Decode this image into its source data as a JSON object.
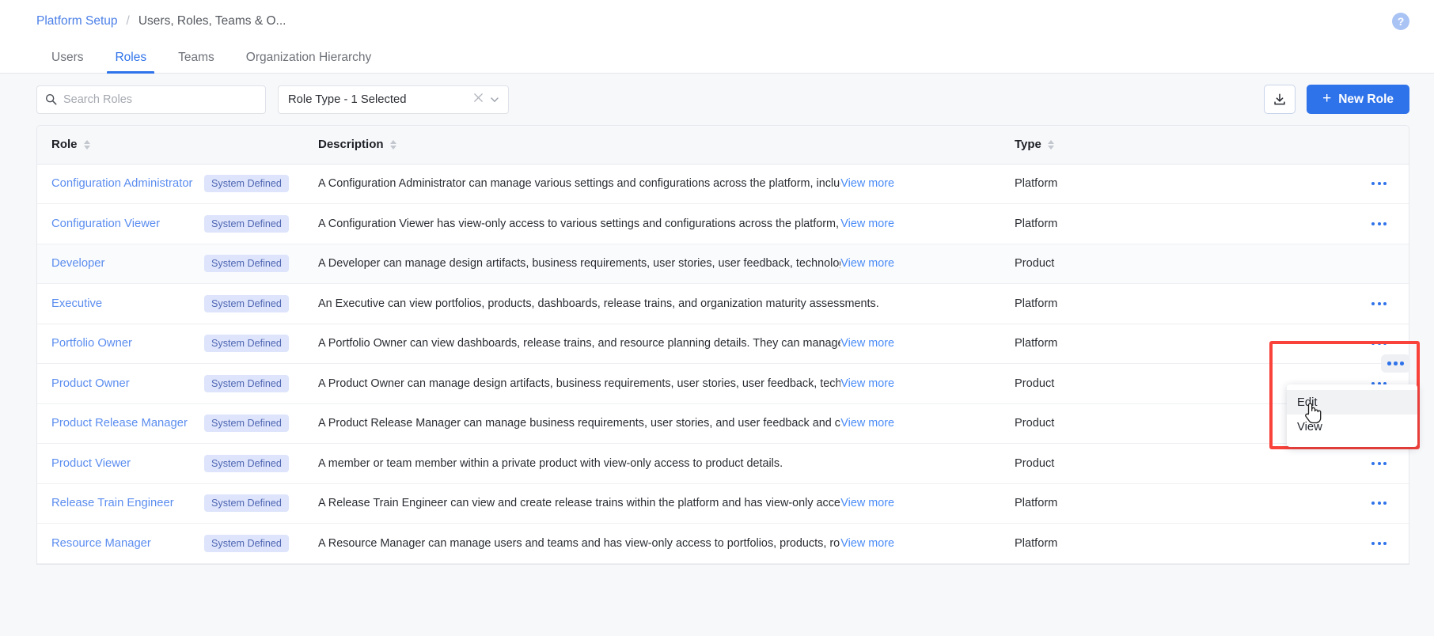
{
  "breadcrumb": {
    "root": "Platform Setup",
    "separator": "/",
    "current": "Users, Roles, Teams & O..."
  },
  "help": {
    "glyph": "?"
  },
  "tabs": [
    {
      "label": "Users",
      "active": false
    },
    {
      "label": "Roles",
      "active": true
    },
    {
      "label": "Teams",
      "active": false
    },
    {
      "label": "Organization Hierarchy",
      "active": false
    }
  ],
  "toolbar": {
    "search": {
      "placeholder": "Search Roles",
      "value": ""
    },
    "filter": {
      "label": "Role Type - 1 Selected"
    },
    "download_label": "Download",
    "new_role_label": "New Role",
    "new_role_plus": "+"
  },
  "colors": {
    "accent": "#2f73ea",
    "link": "#5b8def",
    "badge_bg": "#dde4fb",
    "badge_text": "#4f66b3",
    "highlight": "#f9423a"
  },
  "table": {
    "columns": [
      {
        "label": "Role",
        "sortable": true
      },
      {
        "label": "Description",
        "sortable": true
      },
      {
        "label": "Type",
        "sortable": true
      },
      {
        "label": "",
        "sortable": false
      }
    ],
    "view_more_label": "View more",
    "rows": [
      {
        "role": "Configuration Administrator",
        "badge": "System Defined",
        "description": "A Configuration Administrator can manage various settings and configurations across the platform, including user de",
        "truncated": true,
        "type": "Platform"
      },
      {
        "role": "Configuration Viewer",
        "badge": "System Defined",
        "description": "A Configuration Viewer has view-only access to various settings and configurations across the platform, including us",
        "truncated": true,
        "type": "Platform"
      },
      {
        "role": "Developer",
        "badge": "System Defined",
        "description": "A Developer can manage design artifacts, business requirements, user stories, user feedback, technologies, develop",
        "truncated": true,
        "type": "Product"
      },
      {
        "role": "Executive",
        "badge": "System Defined",
        "description": "An Executive can view portfolios, products, dashboards, release trains, and organization maturity assessments.",
        "truncated": false,
        "type": "Platform"
      },
      {
        "role": "Portfolio Owner",
        "badge": "System Defined",
        "description": "A Portfolio Owner can view dashboards, release trains, and resource planning details. They can manage portfolios a",
        "truncated": true,
        "type": "Platform"
      },
      {
        "role": "Product Owner",
        "badge": "System Defined",
        "description": "A Product Owner can manage design artifacts, business requirements, user stories, user feedback, technologies, de",
        "truncated": true,
        "type": "Product"
      },
      {
        "role": "Product Release Manager",
        "badge": "System Defined",
        "description": "A Product Release Manager can manage business requirements, user stories, and user feedback and can edit produ",
        "truncated": true,
        "type": "Product"
      },
      {
        "role": "Product Viewer",
        "badge": "System Defined",
        "description": "A member or team member within a private product with view-only access to product details.",
        "truncated": false,
        "type": "Product"
      },
      {
        "role": "Release Train Engineer",
        "badge": "System Defined",
        "description": "A Release Train Engineer can view and create release trains within the platform and has view-only access to portfoli",
        "truncated": true,
        "type": "Platform"
      },
      {
        "role": "Resource Manager",
        "badge": "System Defined",
        "description": "A Resource Manager can manage users and teams and has view-only access to portfolios, products, roles, resource",
        "truncated": true,
        "type": "Platform"
      }
    ]
  },
  "row_menu": {
    "items": [
      {
        "label": "Edit",
        "hovered": true
      },
      {
        "label": "View",
        "hovered": false
      }
    ]
  }
}
